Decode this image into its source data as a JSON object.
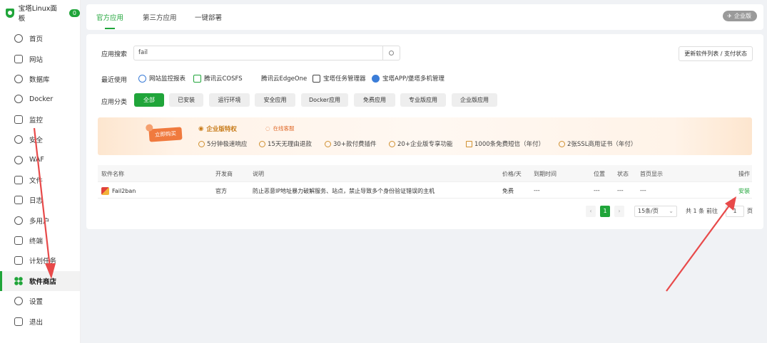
{
  "brand": {
    "name": "宝塔Linux面板",
    "badge": "0"
  },
  "sidebar": {
    "items": [
      {
        "label": "首页",
        "icon": "home-icon"
      },
      {
        "label": "网站",
        "icon": "website-icon"
      },
      {
        "label": "数据库",
        "icon": "database-icon"
      },
      {
        "label": "Docker",
        "icon": "docker-icon"
      },
      {
        "label": "监控",
        "icon": "monitor-icon"
      },
      {
        "label": "安全",
        "icon": "shield-icon"
      },
      {
        "label": "WAF",
        "icon": "waf-icon"
      },
      {
        "label": "文件",
        "icon": "folder-icon"
      },
      {
        "label": "日志",
        "icon": "log-icon"
      },
      {
        "label": "多用户",
        "icon": "users-icon"
      },
      {
        "label": "终端",
        "icon": "terminal-icon"
      },
      {
        "label": "计划任务",
        "icon": "calendar-icon"
      },
      {
        "label": "软件商店",
        "icon": "app-store-icon",
        "active": true
      },
      {
        "label": "设置",
        "icon": "gear-icon"
      },
      {
        "label": "退出",
        "icon": "logout-icon"
      }
    ]
  },
  "tabs": [
    {
      "label": "官方应用"
    },
    {
      "label": "第三方应用"
    },
    {
      "label": "一键部署"
    }
  ],
  "enterprise_badge": "企业版",
  "search": {
    "label": "应用搜索",
    "value": "fail"
  },
  "update_button": "更新软件列表 / 支付状态",
  "recent": {
    "label": "最近使用",
    "items": [
      "网站监控报表",
      "腾讯云COSFS",
      "腾讯云EdgeOne",
      "宝塔任务管理器",
      "宝塔APP/堡塔多机管理"
    ]
  },
  "categories": {
    "label": "应用分类",
    "items": [
      "全部",
      "已安装",
      "运行环境",
      "安全应用",
      "Docker应用",
      "免费应用",
      "专业版应用",
      "企业版应用"
    ]
  },
  "banner": {
    "buy": "立即购买",
    "title": "企业版特权",
    "service": "在线客服",
    "features": [
      "5分钟极速响应",
      "15天无理由退款",
      "30+款付费插件",
      "20+企业版专享功能",
      "1000条免费短信（年付）",
      "2张SSL商用证书（年付）"
    ]
  },
  "table": {
    "headers": [
      "软件名称",
      "开发商",
      "说明",
      "价格/天",
      "到期时间",
      "位置",
      "状态",
      "首页显示",
      "操作"
    ],
    "rows": [
      {
        "name": "Fail2ban",
        "vendor": "官方",
        "desc": "防止恶意IP地址暴力破解服务、站点，禁止导致多个身份验证错误的主机",
        "price": "免费",
        "expire": "---",
        "position": "---",
        "status": "---",
        "home": "---",
        "action": "安装"
      }
    ]
  },
  "pagination": {
    "current": "1",
    "per_page": "15条/页",
    "total": "共 1 条",
    "goto": "前往",
    "page_input": "1",
    "page_unit": "页"
  },
  "colors": {
    "accent": "#20a53a",
    "annotation": "#e84a4a"
  }
}
